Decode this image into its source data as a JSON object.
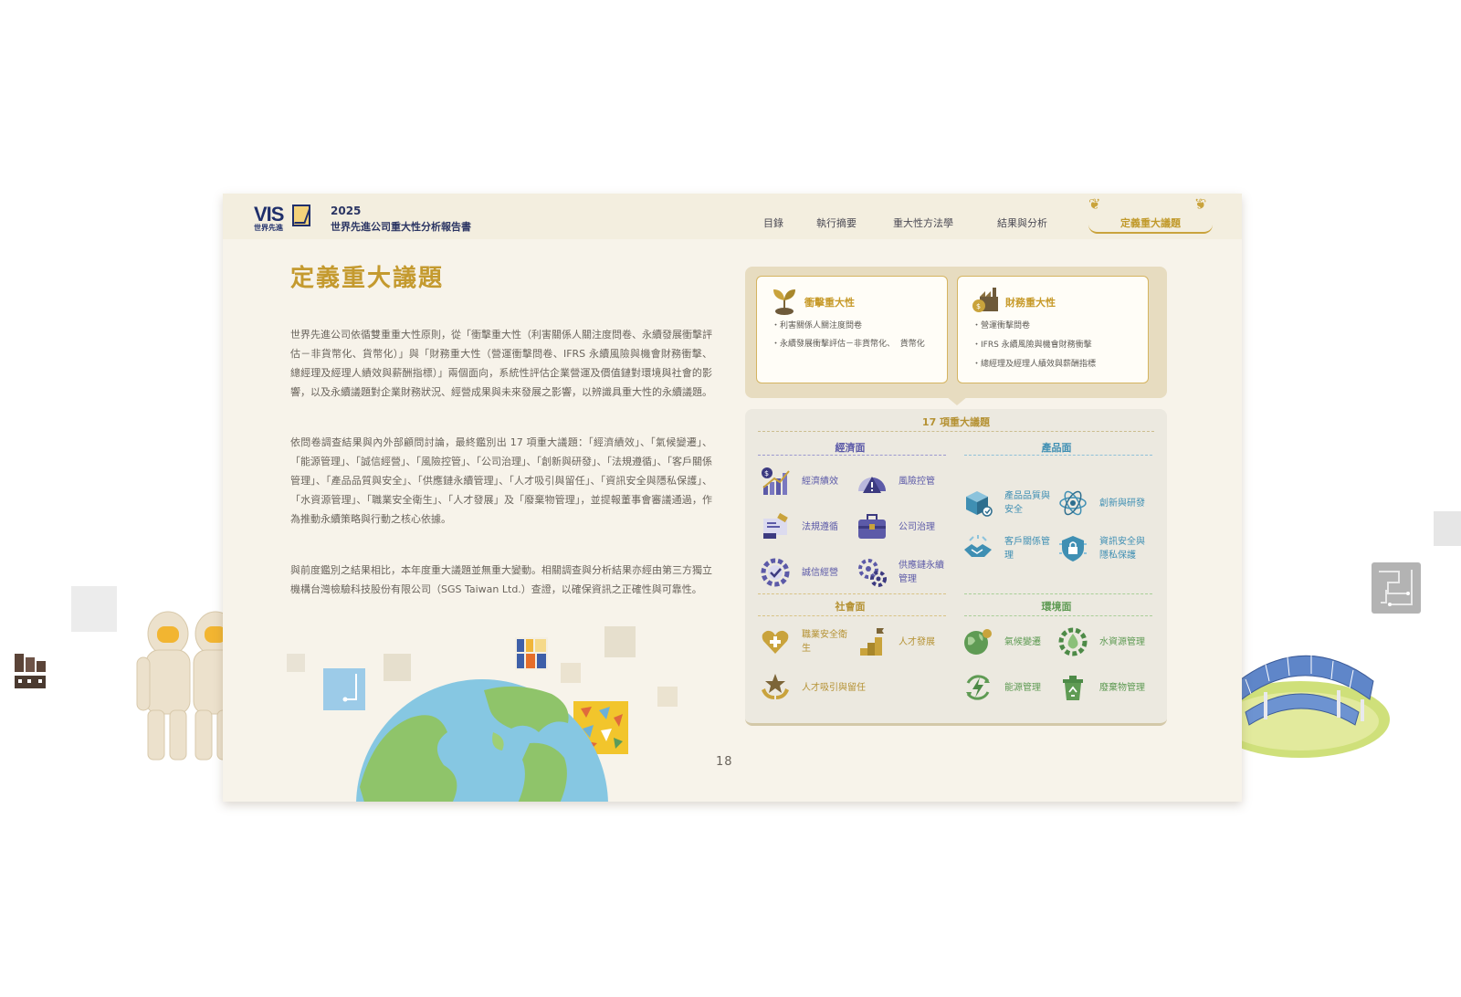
{
  "header": {
    "logo_text": "VIS",
    "logo_sub": "世界先進",
    "year": "2025",
    "report_title": "世界先進公司重大性分析報告書",
    "nav": [
      "目錄",
      "執行摘要",
      "重大性方法學",
      "結果與分析"
    ],
    "nav_active": "定義重大議題"
  },
  "main": {
    "title": "定義重大議題",
    "paragraphs": [
      "世界先進公司依循雙重重大性原則，從「衝擊重大性（利害關係人關注度問卷、永續發展衝擊評估－非貨幣化、貨幣化）」與「財務重大性（營運衝擊問卷、IFRS 永續風險與機會財務衝擊、總經理及經理人績效與薪酬指標）」兩個面向，系統性評估企業營運及價值鏈對環境與社會的影響，以及永續議題對企業財務狀況、經營成果與未來發展之影響，以辨識具重大性的永續議題。",
      "依問卷調查結果與內外部顧問討論，最終鑑別出 17 項重大議題：「經濟績效」、「氣候變遷」、「能源管理」、「誠信經營」、「風險控管」、「公司治理」、「創新與研發」、「法規遵循」、「客戶關係管理」、「產品品質與安全」、「供應鏈永續管理」、「人才吸引與留任」、「資訊安全與隱私保護」、「水資源管理」、「職業安全衛生」、「人才發展」及「廢棄物管理」，並提報董事會審議通過，作為推動永續策略與行動之核心依據。",
      "與前度鑑別之結果相比，本年度重大議題並無重大變動。相關調查與分析結果亦經由第三方獨立機構台灣檢驗科技股份有限公司（SGS Taiwan Ltd.）查證，以確保資訊之正確性與可靠性。"
    ]
  },
  "materiality": {
    "impact": {
      "title": "衝擊重大性",
      "items": [
        "・利害關係人關注度問卷",
        "・永續發展衝擊評估－非貨幣化、  貨幣化"
      ]
    },
    "financial": {
      "title": "財務重大性",
      "items": [
        "・營運衝擊問卷",
        "・IFRS 永續風險與機會財務衝擊",
        "・總經理及經理人績效與薪酬指標"
      ]
    }
  },
  "issues": {
    "title": "17 項重大議題",
    "economic": {
      "label": "經濟面",
      "items": [
        "經濟績效",
        "風險控管",
        "法規遵循",
        "公司治理",
        "誠信經營",
        "供應鏈永續管理"
      ]
    },
    "product": {
      "label": "產品面",
      "items": [
        "產品品質與安全",
        "創新與研發",
        "客戶關係管理",
        "資訊安全與隱私保護"
      ]
    },
    "social": {
      "label": "社會面",
      "items": [
        "職業安全衛生",
        "人才發展",
        "人才吸引與留任"
      ]
    },
    "environment": {
      "label": "環境面",
      "items": [
        "氣候變遷",
        "水資源管理",
        "能源管理",
        "廢棄物管理"
      ]
    }
  },
  "page_number": "18",
  "colors": {
    "gold": "#c49a2f",
    "economic": "#5c5aa8",
    "product": "#3f8fb3",
    "social": "#b59234",
    "environment": "#5f9b54"
  }
}
